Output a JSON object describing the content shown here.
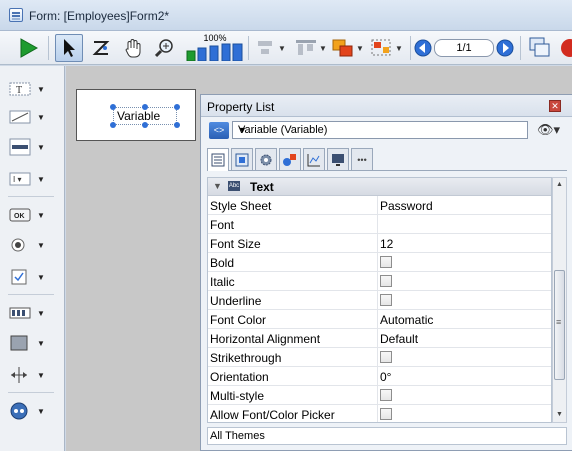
{
  "window": {
    "title": "Form: [Employees]Form2*"
  },
  "toolbar": {
    "zoom": "100%",
    "page": "1/1"
  },
  "property_list": {
    "title": "Property List",
    "object_selector": "Variable (Variable)",
    "section": "Text",
    "rows": [
      {
        "label": "Style Sheet",
        "value": "Password",
        "type": "text"
      },
      {
        "label": "Font",
        "value": "",
        "type": "text"
      },
      {
        "label": "Font Size",
        "value": "12",
        "type": "text"
      },
      {
        "label": "Bold",
        "value": "",
        "type": "checkbox"
      },
      {
        "label": "Italic",
        "value": "",
        "type": "checkbox"
      },
      {
        "label": "Underline",
        "value": "",
        "type": "checkbox"
      },
      {
        "label": "Font Color",
        "value": "Automatic",
        "type": "text"
      },
      {
        "label": "Horizontal Alignment",
        "value": "Default",
        "type": "text"
      },
      {
        "label": "Strikethrough",
        "value": "",
        "type": "checkbox"
      },
      {
        "label": "Orientation",
        "value": "0°",
        "type": "text"
      },
      {
        "label": "Multi-style",
        "value": "",
        "type": "checkbox"
      },
      {
        "label": "Allow Font/Color Picker",
        "value": "",
        "type": "checkbox"
      }
    ],
    "footer": "All Themes"
  },
  "canvas": {
    "variable_label": "Variable"
  },
  "colors": {
    "accent": "#2f6fd6",
    "run": "#1e9b2f"
  }
}
